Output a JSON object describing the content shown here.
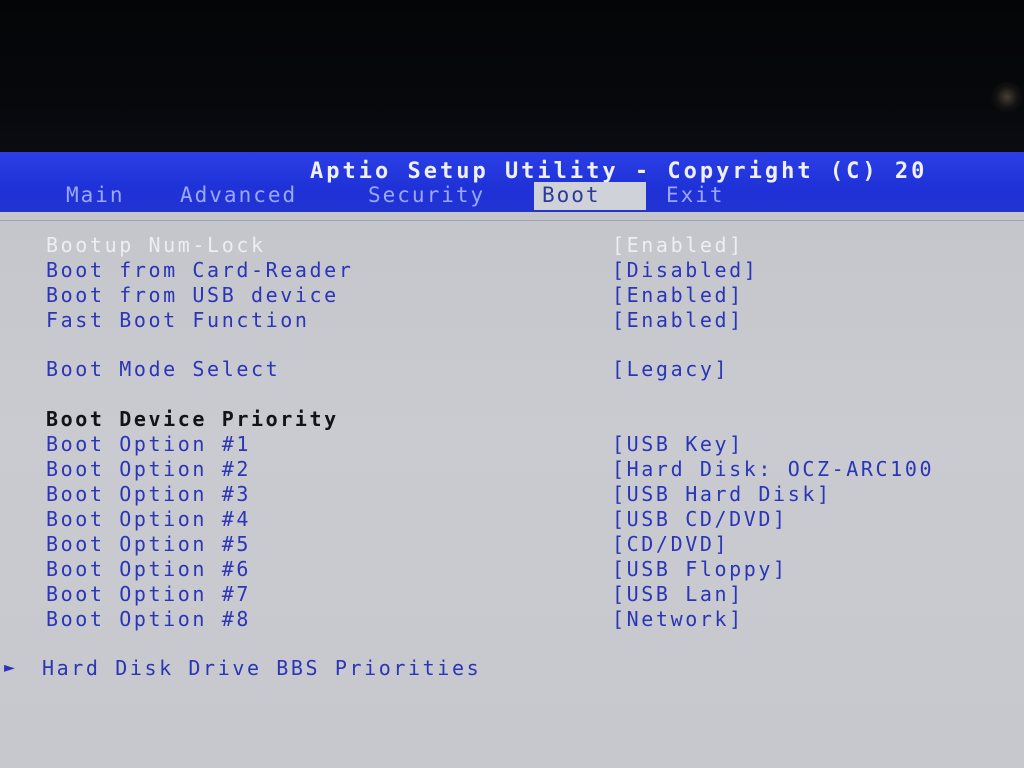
{
  "header": {
    "title": "Aptio Setup Utility - Copyright (C) 20"
  },
  "tabs": [
    {
      "label": "Main",
      "active": false
    },
    {
      "label": "Advanced",
      "active": false
    },
    {
      "label": "Security",
      "active": false
    },
    {
      "label": "Boot",
      "active": true
    },
    {
      "label": "Exit",
      "active": false
    }
  ],
  "settings": {
    "bootup_numlock": {
      "label": "Bootup Num-Lock",
      "value": "[Enabled]"
    },
    "boot_card_reader": {
      "label": "Boot from Card-Reader",
      "value": "[Disabled]"
    },
    "boot_usb": {
      "label": "Boot from USB device",
      "value": "[Enabled]"
    },
    "fast_boot": {
      "label": "Fast Boot Function",
      "value": "[Enabled]"
    },
    "boot_mode": {
      "label": "Boot Mode Select",
      "value": "[Legacy]"
    }
  },
  "priority": {
    "heading": "Boot Device Priority",
    "options": [
      {
        "label": "Boot Option #1",
        "value": "[USB Key]"
      },
      {
        "label": "Boot Option #2",
        "value": "[Hard Disk: OCZ-ARC100"
      },
      {
        "label": "Boot Option #3",
        "value": "[USB Hard Disk]"
      },
      {
        "label": "Boot Option #4",
        "value": "[USB CD/DVD]"
      },
      {
        "label": "Boot Option #5",
        "value": "[CD/DVD]"
      },
      {
        "label": "Boot Option #6",
        "value": "[USB Floppy]"
      },
      {
        "label": "Boot Option #7",
        "value": "[USB Lan]"
      },
      {
        "label": "Boot Option #8",
        "value": "[Network]"
      }
    ]
  },
  "submenu": {
    "arrow": "►",
    "label": "Hard Disk Drive BBS Priorities"
  },
  "colors": {
    "header_blue": "#1f32d8",
    "body_gray": "#c6c8cd",
    "text_blue": "#2a35b8",
    "active_tab_bg": "#cfd2d8"
  }
}
